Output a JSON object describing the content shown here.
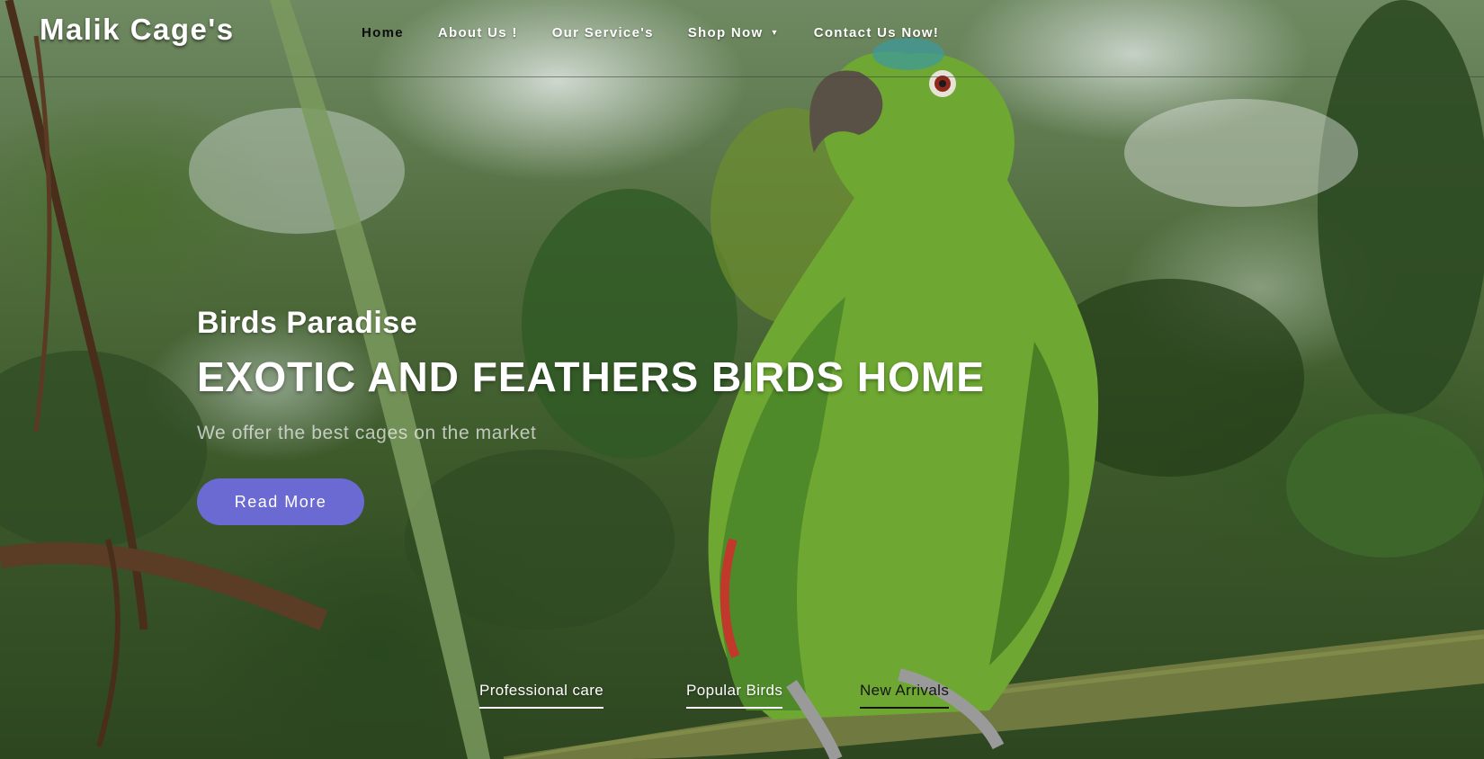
{
  "brand": {
    "name": "Malik Cage's"
  },
  "nav": {
    "items": [
      {
        "label": "Home",
        "active": true
      },
      {
        "label": "About Us !",
        "active": false
      },
      {
        "label": "Our Service's",
        "active": false
      },
      {
        "label": "Shop Now",
        "active": false,
        "dropdown": true
      },
      {
        "label": "Contact Us Now!",
        "active": false
      }
    ]
  },
  "hero": {
    "subtitle": "Birds Paradise",
    "title": "EXOTIC AND FEATHERS BIRDS HOME",
    "text": "We offer the best cages on the market",
    "button_label": "Read More"
  },
  "tabs": [
    {
      "label": "Professional care"
    },
    {
      "label": "Popular Birds"
    },
    {
      "label": "New Arrivals"
    }
  ],
  "colors": {
    "accent_button": "#6b6ad3",
    "nav_active": "#0d0d0d",
    "parrot_green": "#6ea832"
  },
  "icons": {
    "dropdown": "caret-down-icon"
  }
}
